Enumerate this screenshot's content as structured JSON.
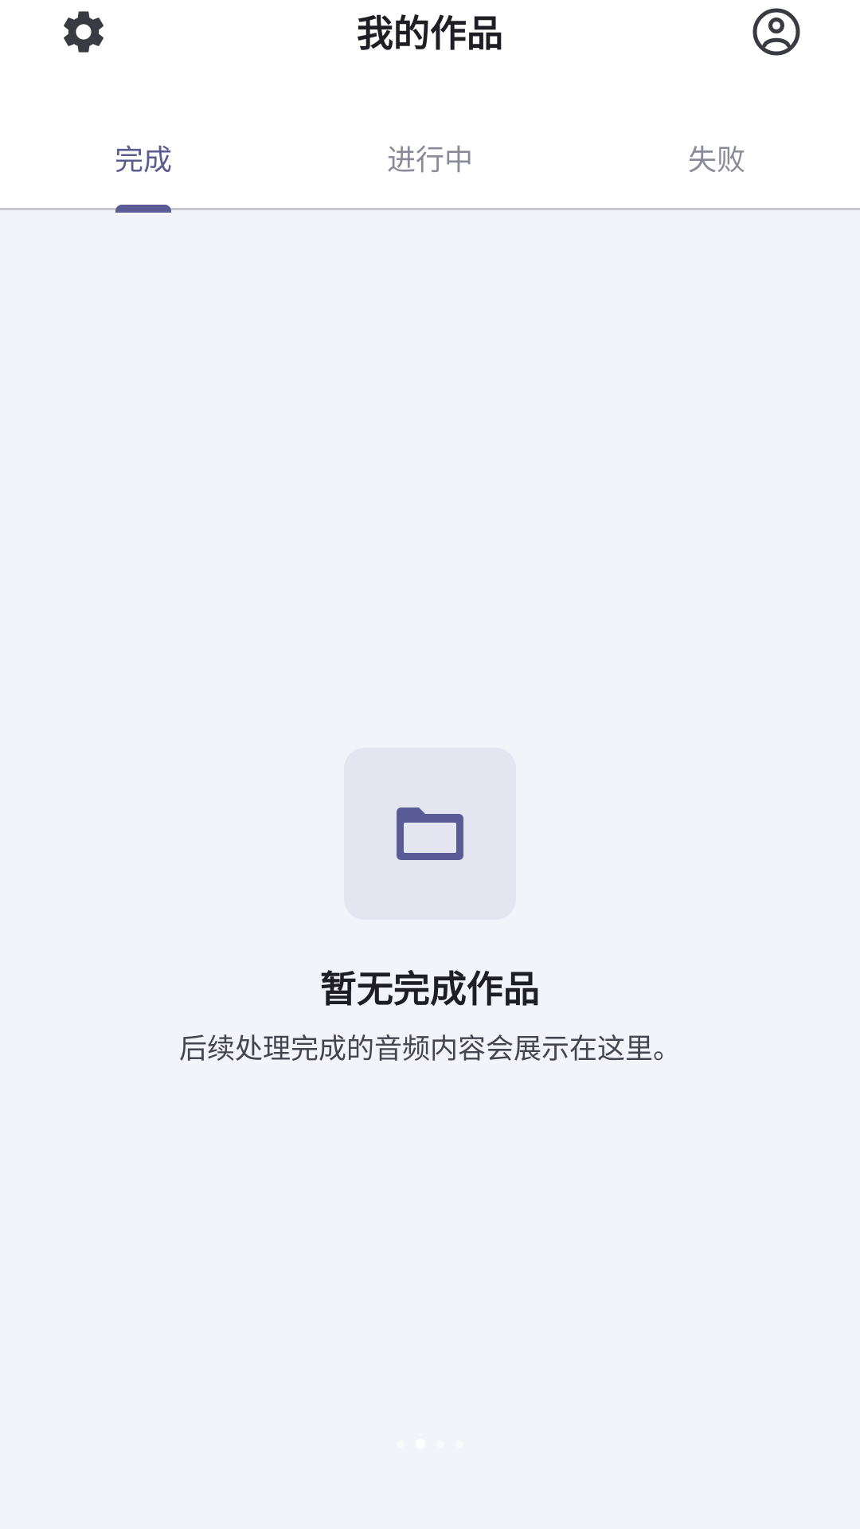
{
  "header": {
    "title": "我的作品",
    "settings_icon": "gear-icon",
    "account_icon": "account-circle-icon"
  },
  "tabs": [
    {
      "label": "完成",
      "active": true
    },
    {
      "label": "进行中",
      "active": false
    },
    {
      "label": "失败",
      "active": false
    }
  ],
  "empty_state": {
    "icon": "folder-icon",
    "title": "暂无完成作品",
    "description": "后续处理完成的音频内容会展示在这里。"
  },
  "pager": {
    "count": 4,
    "active_index": 1
  },
  "colors": {
    "accent": "#5a5b94",
    "background": "#f3f4f9",
    "icon_box": "#e3e5f1",
    "tab_inactive": "#8a8a98"
  }
}
